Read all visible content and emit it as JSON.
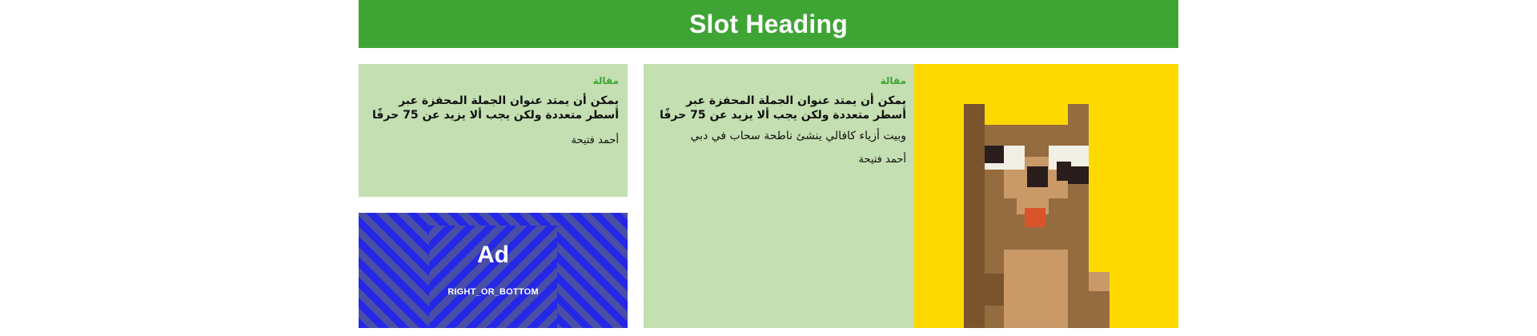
{
  "slot": {
    "heading": "Slot Heading"
  },
  "cards": [
    {
      "category": "مقالة",
      "headline": "يمكن أن يمتد عنوان الجملة المحفزة عبر أسطر متعددة ولكن يجب ألا يزيد عن 75 حرفًا",
      "author": "أحمد فتيحة"
    },
    {
      "category": "مقالة",
      "headline": "يمكن أن يمتد عنوان الجملة المحفزة عبر أسطر متعددة ولكن يجب ألا يزيد عن 75 حرفًا",
      "excerpt": "وبيت أزياء كافالي ينشئ ناطحة سحاب في دبي",
      "author": "أحمد فتيحة",
      "image_icon": "pixel-bear-icon"
    }
  ],
  "ad": {
    "title": "Ad",
    "slot_name": "RIGHT_OR_BOTTOM"
  },
  "colors": {
    "heading_bg": "#3ea535",
    "card_bg": "#c4dfb1",
    "category_text": "#3ea535",
    "thumb_bg": "#fdd900",
    "ad_stripe_a": "#2427e6",
    "ad_stripe_b": "#4a4fa6"
  }
}
